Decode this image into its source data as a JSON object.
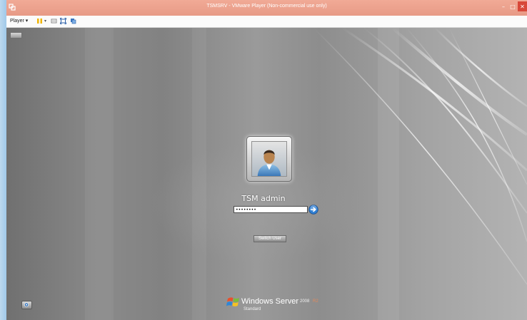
{
  "window": {
    "title": "TSMSRV - VMware Player (Non-commercial use only)",
    "minimize_glyph": "–",
    "maximize_glyph": "□",
    "close_glyph": "✕"
  },
  "toolbar": {
    "player_menu_label": "Player ▾",
    "icons": [
      "pause-icon",
      "send-ctrl-alt-del-icon",
      "removable-devices-icon",
      "fullscreen-icon",
      "unity-icon"
    ]
  },
  "login": {
    "user_name": "TSM admin",
    "password_value": "••••••••",
    "switch_user_label": "Switch User"
  },
  "branding": {
    "product": "Windows Server",
    "version": "2008",
    "version_suffix": "R2",
    "edition": "Standard"
  },
  "colors": {
    "title_bar": "#e79a86",
    "close_button": "#d8483a",
    "guest_background": "#8d8d8d",
    "arrow_button": "#2f7fd3"
  }
}
